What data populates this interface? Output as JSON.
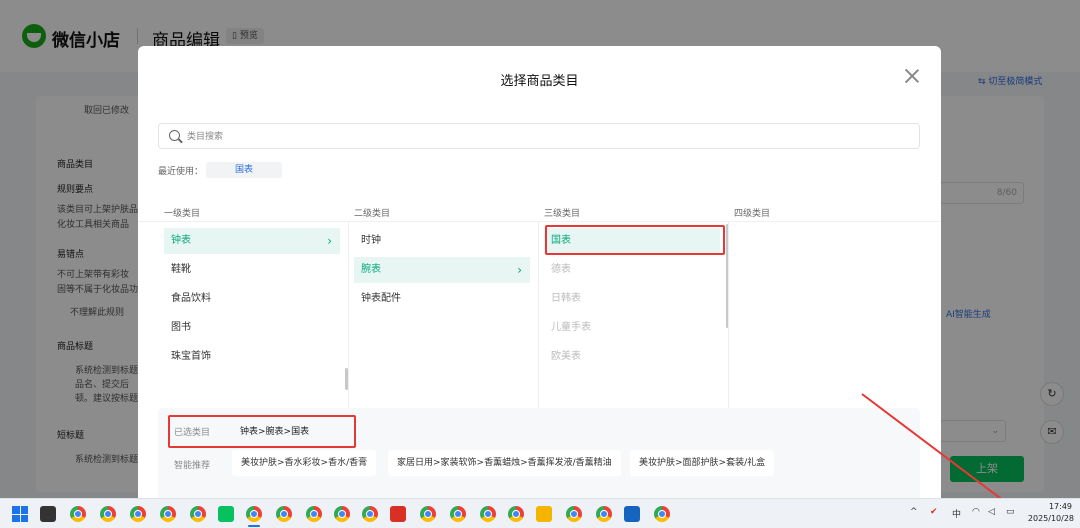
{
  "background": {
    "logo_text": "微信小店",
    "page_title": "商品编辑",
    "preview_label": "预览",
    "simple_mode": "切至极简模式",
    "saved_text": "取回已修改",
    "left_texts": [
      "商品类目",
      "规则要点",
      "该类目可上架护肤品",
      "化妆工具相关商品",
      "易错点",
      "不可上架带有彩妆",
      "固等不属于化妆品功",
      "不理解此规则",
      "商品标题",
      "系统检测到标题",
      "品名、提交后",
      "顿。建议按标题",
      "短标题",
      "系统检测到标题"
    ],
    "title_counter": "8/60",
    "ai_generate": "AI智能生成",
    "publish_label": "上架"
  },
  "modal": {
    "title": "选择商品类目",
    "search_placeholder": "类目搜索",
    "recent_label": "最近使用：",
    "recent_item": "国表",
    "column_headers": [
      "一级类目",
      "二级类目",
      "三级类目",
      "四级类目"
    ],
    "level1": [
      "钟表",
      "鞋靴",
      "食品饮料",
      "图书",
      "珠宝首饰"
    ],
    "level2": [
      "时钟",
      "腕表",
      "钟表配件"
    ],
    "level3": [
      "国表",
      "德表",
      "日韩表",
      "儿童手表",
      "欧美表"
    ],
    "selected_label": "已选类目",
    "selected_value": "钟表>腕表>国表",
    "recommend_label": "智能推荐",
    "recommendations": [
      "美妆护肤>香水彩妆>香水/香膏",
      "家居日用>家装软饰>香薰蜡烛>香薰挥发液/香薰精油",
      "美妆护肤>面部护肤>套装/礼盒"
    ]
  },
  "taskbar": {
    "tray_lang": "中",
    "time": "17:49",
    "date": "2025/10/28"
  },
  "colors": {
    "accent": "#07a879",
    "active_bg": "#e8f6f3",
    "annotation": "#e53935",
    "publish": "#07c160"
  }
}
